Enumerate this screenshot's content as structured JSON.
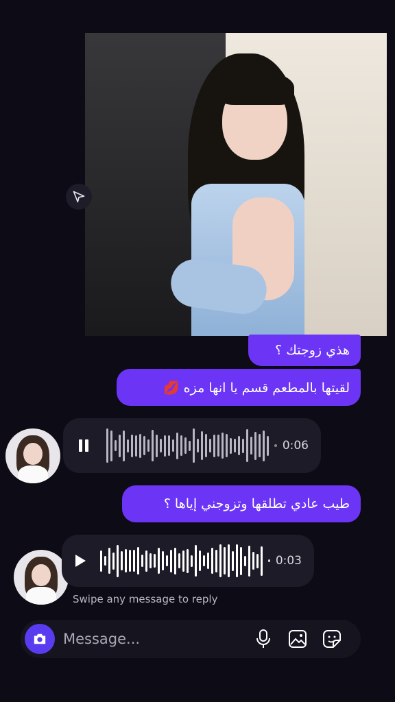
{
  "messages": {
    "m1": "هذي زوجتك ؟",
    "m2": "لقيتها بالمطعم قسم يا انها مزه 💋",
    "m3": "طيب عادي تطلقها وتزوجني إياها ؟"
  },
  "voice": [
    {
      "state": "playing",
      "duration": "0:06"
    },
    {
      "state": "paused",
      "duration": "0:03"
    }
  ],
  "hint": "Swipe any message to reply",
  "composer": {
    "placeholder": "Message..."
  },
  "icons": [
    "send-icon",
    "pause-icon",
    "play-icon",
    "camera-icon",
    "microphone-icon",
    "gallery-icon",
    "sticker-icon"
  ],
  "colors": {
    "accent": "#6c35f5",
    "background": "#0c0b16",
    "voice_bubble": "#1c1b27"
  }
}
